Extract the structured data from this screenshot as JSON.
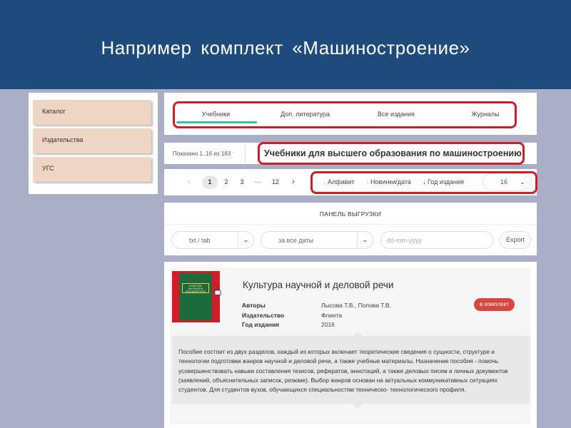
{
  "header": {
    "title": "Например  комплект  «Машиностроение»"
  },
  "sidebar": {
    "items": [
      {
        "label": "Каталог"
      },
      {
        "label": "Издательства"
      },
      {
        "label": "УГС"
      }
    ]
  },
  "tabs": [
    {
      "label": "Учебники",
      "active": true
    },
    {
      "label": "Доп. литература"
    },
    {
      "label": "Все издания"
    },
    {
      "label": "Журналы"
    }
  ],
  "results": {
    "count_text": "Показано 1..16 из 183",
    "title": "Учебники для высшего образования по машиностроению"
  },
  "pagination": {
    "prev_icon": "chevron-left-icon",
    "pages": [
      "1",
      "2",
      "3",
      "···",
      "12"
    ],
    "current": "1",
    "next_icon": "chevron-right-icon"
  },
  "sort": {
    "options": [
      {
        "label": "Алфавит"
      },
      {
        "label": "Новинки/дата"
      },
      {
        "label": "Год издания"
      }
    ],
    "per_page": "16"
  },
  "export": {
    "title": "ПАНЕЛЬ ВЫГРУЗКИ",
    "format": "txt / tab",
    "period": "за все даты",
    "date_placeholder": "dd-mm-yyyy",
    "button": "Export"
  },
  "book": {
    "title": "Культура научной и деловой речи",
    "cover_text": "КУЛЬТУРА НАУЧНОЙ И ДЕЛОВОЙ РЕЧИ",
    "fields": [
      {
        "key": "Авторы",
        "value": "Лысова Т.В., Попова Т.В."
      },
      {
        "key": "Издательство",
        "value": "Флинта"
      },
      {
        "key": "Год издания",
        "value": "2016"
      }
    ],
    "add_button": "в комплект",
    "description": "Пособие состоит из двух разделов, каждый из которых включает теоретические сведения о сущности, структуре и технологии подготовки жанров научной и деловой речи, а также учебные материалы. Назначение пособия - помочь усовершенствовать навыки составления тезисов, рефератов, аннотаций, а также деловых писем и личных документов (заявлений, объяснительных записок, резюме). Выбор жанров основан на актуальных коммуникативных ситуациях студентов. Для студентов вузов, обучающихся специальностям техническо- технологического профиля."
  },
  "colors": {
    "header_bg": "#1f4a7c",
    "page_bg": "#a9aec6",
    "sidebar_item_bg": "#eed5c4",
    "highlight_border": "#d61a2a",
    "active_tab": "#34c3a0",
    "add_button": "#d9463f"
  }
}
